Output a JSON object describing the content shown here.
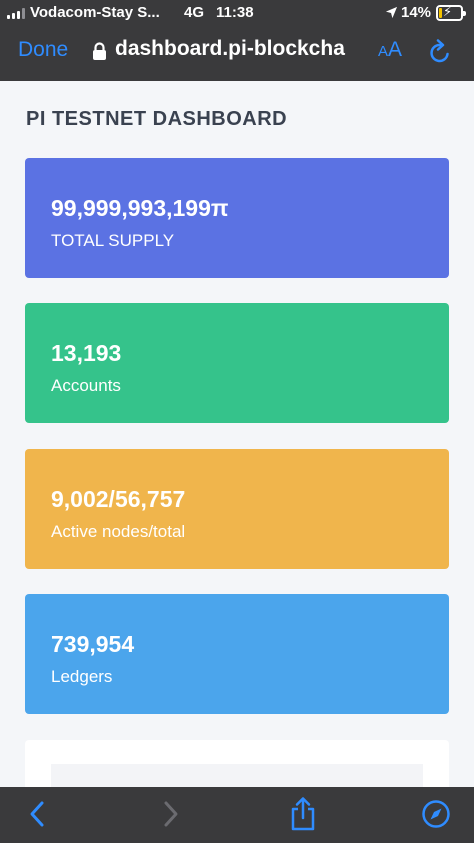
{
  "status_bar": {
    "carrier": "Vodacom-Stay S...",
    "network": "4G",
    "time": "11:38",
    "battery_percent": "14%",
    "battery_level": 0.14
  },
  "browser": {
    "done_label": "Done",
    "url": "dashboard.pi-blockcha",
    "text_size_small": "A",
    "text_size_large": "A"
  },
  "dashboard": {
    "title": "PI TESTNET DASHBOARD",
    "cards": [
      {
        "value": "99,999,993,199π",
        "label": "TOTAL SUPPLY"
      },
      {
        "value": "13,193",
        "label": "Accounts"
      },
      {
        "value": "9,002/56,757",
        "label": "Active nodes/total"
      },
      {
        "value": "739,954",
        "label": "Ledgers"
      }
    ]
  },
  "colors": {
    "supply": "#5b72e3",
    "accounts": "#35c38b",
    "nodes": "#f0b54c",
    "ledgers": "#4ba5ec",
    "ios_blue": "#2f8cff"
  },
  "icons": {
    "location": "location-arrow-icon",
    "lock": "lock-icon",
    "reload": "reload-icon",
    "back": "chevron-left-icon",
    "forward": "chevron-right-icon",
    "share": "share-icon",
    "compass": "compass-icon"
  }
}
